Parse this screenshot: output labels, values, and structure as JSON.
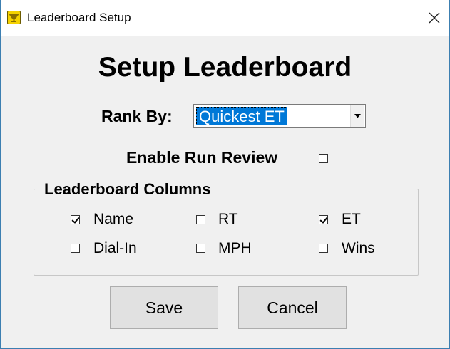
{
  "window": {
    "title": "Leaderboard Setup",
    "icon": "trophy-icon",
    "close_glyph": "✕"
  },
  "dialog": {
    "heading": "Setup Leaderboard",
    "rank_by": {
      "label": "Rank By:",
      "selected": "Quickest ET"
    },
    "run_review": {
      "label": "Enable Run Review",
      "checked": false
    },
    "columns_group": {
      "title": "Leaderboard Columns",
      "options": [
        {
          "label": "Name",
          "checked": true
        },
        {
          "label": "RT",
          "checked": false
        },
        {
          "label": "ET",
          "checked": true
        },
        {
          "label": "Dial-In",
          "checked": false
        },
        {
          "label": "MPH",
          "checked": false
        },
        {
          "label": "Wins",
          "checked": false
        }
      ]
    },
    "buttons": {
      "save": "Save",
      "cancel": "Cancel"
    }
  },
  "colors": {
    "accent": "#0078d7",
    "dialog_bg": "#f0f0f0",
    "button_bg": "#e1e1e1",
    "window_border": "#3c7fb1"
  }
}
